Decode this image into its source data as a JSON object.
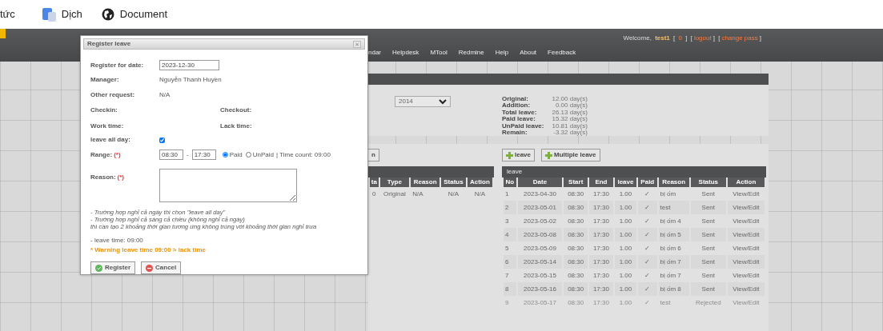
{
  "bookmarks": [
    {
      "kind": "text",
      "label": "tức"
    },
    {
      "kind": "translate",
      "label": "Dịch"
    },
    {
      "kind": "globe",
      "label": "Document"
    }
  ],
  "header": {
    "welcome": "Welcome,",
    "user": "test1",
    "bracket_open": "[",
    "bracket_close": "]",
    "links": [
      "0",
      "logout",
      "change pass"
    ],
    "nav": [
      "ndar",
      "Helpdesk",
      "MTool",
      "Redmine",
      "Help",
      "About",
      "Feedback"
    ]
  },
  "summary": {
    "year": "2014",
    "stats": [
      {
        "label": "Original:",
        "value": "12.00 day(s)"
      },
      {
        "label": "Addition:",
        "value": "0.00 day(s)"
      },
      {
        "label": "Total leave:",
        "value": "26.13 day(s)"
      },
      {
        "label": "Paid leave:",
        "value": "15.32 day(s)"
      },
      {
        "label": "UnPaid leave:",
        "value": "10.81 day(s)"
      },
      {
        "label": "Remain:",
        "value": "-3.32 day(s)"
      }
    ]
  },
  "left_toolbar": [
    "n"
  ],
  "right_toolbar": [
    "leave",
    "Multiple leave"
  ],
  "left_table": {
    "columns": [
      "ta",
      "Type",
      "Reason",
      "Status",
      "Action"
    ],
    "rows": [
      [
        "0",
        "Original",
        "N/A",
        "N/A",
        "N/A"
      ]
    ]
  },
  "right_table": {
    "title": "leave",
    "columns": [
      "No",
      "Date",
      "Start",
      "End",
      "leave",
      "Paid",
      "Reason",
      "Status",
      "Action"
    ],
    "rows": [
      {
        "no": "1",
        "date": "2023-04-30",
        "start": "08:30",
        "end": "17:30",
        "leave": "1.00",
        "paid": "✓",
        "reason": "bị ốm",
        "status": "Sent",
        "action": "View/Edit",
        "disabled": false
      },
      {
        "no": "2",
        "date": "2023-05-01",
        "start": "08:30",
        "end": "17:30",
        "leave": "1.00",
        "paid": "✓",
        "reason": "test",
        "status": "Sent",
        "action": "View/Edit",
        "disabled": false
      },
      {
        "no": "3",
        "date": "2023-05-02",
        "start": "08:30",
        "end": "17:30",
        "leave": "1.00",
        "paid": "✓",
        "reason": "bị ốm 4",
        "status": "Sent",
        "action": "View/Edit",
        "disabled": false
      },
      {
        "no": "4",
        "date": "2023-05-08",
        "start": "08:30",
        "end": "17:30",
        "leave": "1.00",
        "paid": "✓",
        "reason": "bị ốm 5",
        "status": "Sent",
        "action": "View/Edit",
        "disabled": false
      },
      {
        "no": "5",
        "date": "2023-05-09",
        "start": "08:30",
        "end": "17:30",
        "leave": "1.00",
        "paid": "✓",
        "reason": "bị ốm 6",
        "status": "Sent",
        "action": "View/Edit",
        "disabled": false
      },
      {
        "no": "6",
        "date": "2023-05-14",
        "start": "08:30",
        "end": "17:30",
        "leave": "1.00",
        "paid": "✓",
        "reason": "bị ốm 7",
        "status": "Sent",
        "action": "View/Edit",
        "disabled": false
      },
      {
        "no": "7",
        "date": "2023-05-15",
        "start": "08:30",
        "end": "17:30",
        "leave": "1.00",
        "paid": "✓",
        "reason": "bị ốm 7",
        "status": "Sent",
        "action": "View/Edit",
        "disabled": false
      },
      {
        "no": "8",
        "date": "2023-05-16",
        "start": "08:30",
        "end": "17:30",
        "leave": "1.00",
        "paid": "✓",
        "reason": "bị ốm 8",
        "status": "Sent",
        "action": "View/Edit",
        "disabled": false
      },
      {
        "no": "9",
        "date": "2023-05-17",
        "start": "08:30",
        "end": "17:30",
        "leave": "1.00",
        "paid": "✓",
        "reason": "test",
        "status": "Rejected",
        "action": "View/Edit",
        "disabled": true
      }
    ]
  },
  "dialog": {
    "title": "Register leave",
    "close": "×",
    "date_label": "Register for date:",
    "date": "2023-12-30",
    "manager_label": "Manager:",
    "manager": "Nguyễn Thanh Huyền",
    "other_label": "Other request:",
    "other": "N/A",
    "checkin_label": "Checkin:",
    "checkout_label": "Checkout:",
    "work_label": "Work time:",
    "lack_label": "Lack time:",
    "allday_label": "leave all day:",
    "allday_checked": true,
    "range_label": "Range:",
    "required": "(*)",
    "from": "08:30",
    "dash": "-",
    "to": "17:30",
    "pay_options": [
      {
        "label": "Paid",
        "selected": true
      },
      {
        "label": "UnPaid",
        "selected": false
      }
    ],
    "time_count": "| Time count: 09:00",
    "reason_label": "Reason:",
    "notes": [
      "- Trường hợp nghỉ cả ngày thì chọn \"leave all day\"",
      "- Trường hợp nghỉ cả sáng cả chiều (không nghỉ cả ngày)",
      "thì cần tạo 2 khoảng thời gian tương ứng không trùng với khoảng thời gian nghỉ trưa"
    ],
    "leave_time": "- leave time: 09:00",
    "warning": "* Warning leave time 09:00 > lack time",
    "buttons": [
      {
        "kind": "ok",
        "label": "Register"
      },
      {
        "kind": "cancel",
        "label": "Cancel"
      }
    ]
  }
}
